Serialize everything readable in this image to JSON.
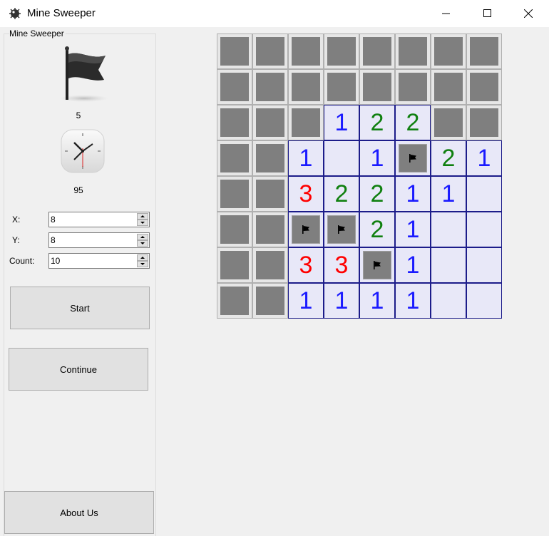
{
  "window": {
    "title": "Mine Sweeper"
  },
  "panel": {
    "group_title": "Mine Sweeper",
    "flags_remaining": "5",
    "time_elapsed": "95",
    "fields": [
      {
        "label": "X:",
        "value": "8"
      },
      {
        "label": "Y:",
        "value": "8"
      },
      {
        "label": "Count:",
        "value": "10"
      }
    ],
    "start_label": "Start",
    "continue_label": "Continue",
    "about_label": "About Us"
  },
  "colors": {
    "number_1": "#1a1aff",
    "number_2": "#108010",
    "number_3": "#ff0000",
    "open_cell_bg": "#e8e8f8",
    "open_cell_border": "#1c1c8a",
    "hidden_cell": "#7f7f7f"
  },
  "board": {
    "rows": [
      [
        "H",
        "H",
        "H",
        "H",
        "H",
        "H",
        "H",
        "H"
      ],
      [
        "H",
        "H",
        "H",
        "H",
        "H",
        "H",
        "H",
        "H"
      ],
      [
        "H",
        "H",
        "H",
        "1",
        "2",
        "2",
        "H",
        "H"
      ],
      [
        "H",
        "H",
        "1",
        "",
        "1",
        "F",
        "2",
        "1"
      ],
      [
        "H",
        "H",
        "3",
        "2",
        "2",
        "1",
        "1",
        ""
      ],
      [
        "H",
        "H",
        "F",
        "F",
        "2",
        "1",
        "",
        ""
      ],
      [
        "H",
        "H",
        "3",
        "3",
        "F",
        "1",
        "",
        ""
      ],
      [
        "H",
        "H",
        "1",
        "1",
        "1",
        "1",
        "",
        ""
      ]
    ]
  }
}
